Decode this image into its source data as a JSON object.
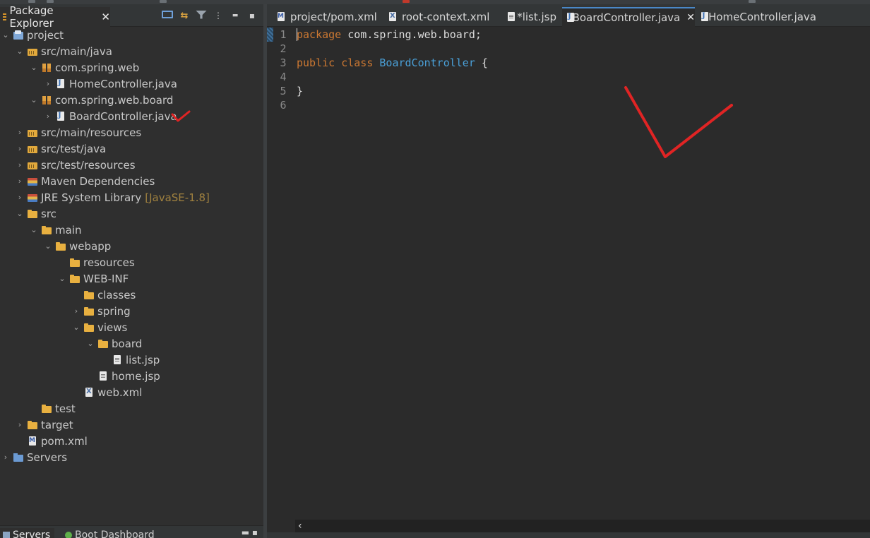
{
  "package_explorer": {
    "tab_label": "Package Explorer",
    "close_glyph": "✕",
    "actions": {
      "collapse_icon": "collapse-all-icon",
      "link_icon": "link-with-editor-icon",
      "filter_icon": "filter-icon",
      "menu_glyph": "⋮",
      "minimize_glyph": "▬",
      "maximize_glyph": "▪"
    },
    "tree": [
      {
        "label": "project",
        "icon": "project-icon",
        "chev": "⌄"
      },
      {
        "label": "src/main/java",
        "icon": "source-folder-icon",
        "chev": "⌄"
      },
      {
        "label": "com.spring.web",
        "icon": "package-icon",
        "chev": "⌄"
      },
      {
        "label": "HomeController.java",
        "icon": "java-file-icon",
        "chev": "›"
      },
      {
        "label": "com.spring.web.board",
        "icon": "package-icon",
        "chev": "⌄"
      },
      {
        "label": "BoardController.java",
        "icon": "java-file-icon",
        "chev": "›"
      },
      {
        "label": "src/main/resources",
        "icon": "source-folder-icon",
        "chev": "›"
      },
      {
        "label": "src/test/java",
        "icon": "source-folder-icon",
        "chev": "›"
      },
      {
        "label": "src/test/resources",
        "icon": "source-folder-icon",
        "chev": "›"
      },
      {
        "label": "Maven Dependencies",
        "icon": "library-icon",
        "chev": "›"
      },
      {
        "label": "JRE System Library",
        "icon": "library-icon",
        "chev": "›",
        "decoration": "[JavaSE-1.8]"
      },
      {
        "label": "src",
        "icon": "folder-icon",
        "chev": "⌄"
      },
      {
        "label": "main",
        "icon": "folder-icon",
        "chev": "⌄"
      },
      {
        "label": "webapp",
        "icon": "folder-icon",
        "chev": "⌄"
      },
      {
        "label": "resources",
        "icon": "folder-icon",
        "chev": ""
      },
      {
        "label": "WEB-INF",
        "icon": "folder-icon",
        "chev": "⌄"
      },
      {
        "label": "classes",
        "icon": "folder-icon",
        "chev": ""
      },
      {
        "label": "spring",
        "icon": "folder-icon",
        "chev": "›"
      },
      {
        "label": "views",
        "icon": "folder-icon",
        "chev": "⌄"
      },
      {
        "label": "board",
        "icon": "folder-icon",
        "chev": "⌄"
      },
      {
        "label": "list.jsp",
        "icon": "file-icon",
        "chev": ""
      },
      {
        "label": "home.jsp",
        "icon": "file-icon",
        "chev": ""
      },
      {
        "label": "web.xml",
        "icon": "xml-file-icon",
        "chev": ""
      },
      {
        "label": "test",
        "icon": "folder-icon",
        "chev": ""
      },
      {
        "label": "target",
        "icon": "folder-icon",
        "chev": "›"
      },
      {
        "label": "pom.xml",
        "icon": "pom-file-icon",
        "chev": ""
      },
      {
        "label": "Servers",
        "icon": "servers-project-icon",
        "chev": "›"
      }
    ]
  },
  "bottom_panel": {
    "tabs": [
      "Servers",
      "Boot Dashboard"
    ]
  },
  "editor": {
    "tabs": [
      {
        "label": "project/pom.xml",
        "icon": "pom-file-icon",
        "active": false
      },
      {
        "label": "root-context.xml",
        "icon": "xml-file-icon",
        "active": false
      },
      {
        "label": "*list.jsp",
        "icon": "file-icon",
        "active": false
      },
      {
        "label": "BoardController.java",
        "icon": "java-file-icon",
        "active": true,
        "close": "✕"
      },
      {
        "label": "HomeController.java",
        "icon": "java-file-icon",
        "active": false
      }
    ],
    "lines": [
      {
        "n": "1",
        "tokens": [
          [
            "kw",
            "package"
          ],
          [
            "",
            " com.spring.web.board;"
          ]
        ]
      },
      {
        "n": "2",
        "tokens": []
      },
      {
        "n": "3",
        "tokens": [
          [
            "kw",
            "public"
          ],
          [
            "",
            " "
          ],
          [
            "kw",
            "class"
          ],
          [
            "",
            " "
          ],
          [
            "cls",
            "BoardController"
          ],
          [
            "",
            " {"
          ]
        ]
      },
      {
        "n": "4",
        "tokens": []
      },
      {
        "n": "5",
        "tokens": [
          [
            "",
            "}"
          ]
        ]
      },
      {
        "n": "6",
        "tokens": []
      }
    ],
    "scroll_left_glyph": "‹"
  },
  "colors": {
    "annotation": "#e02424",
    "keyword": "#cc7832",
    "class_name": "#4aa0d8",
    "active_tab_accent": "#4a88c7"
  }
}
